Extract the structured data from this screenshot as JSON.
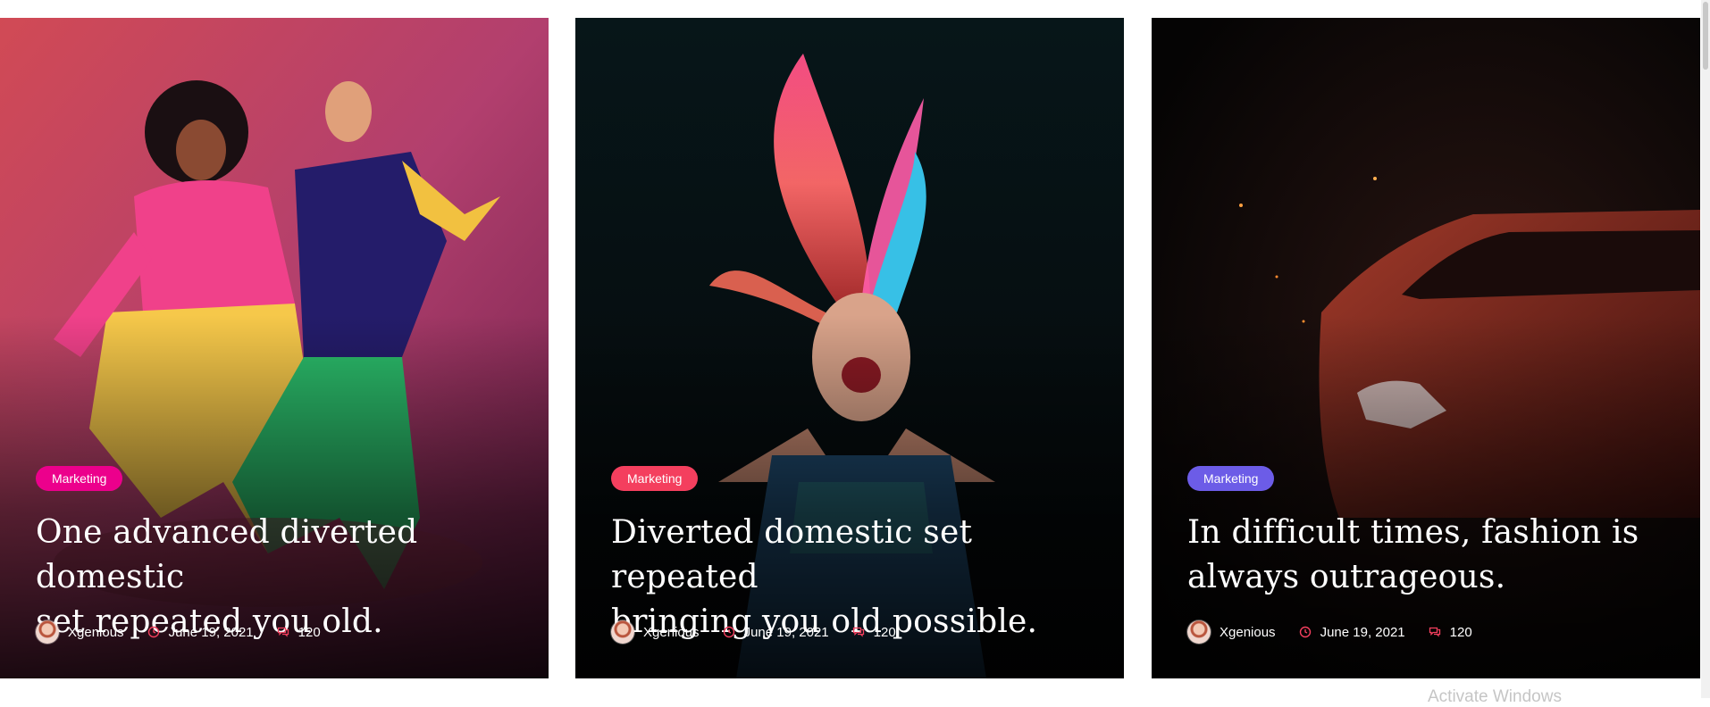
{
  "cards": [
    {
      "category": "Marketing",
      "category_color": "#ec008c",
      "title_line1": "One advanced diverted domestic",
      "title_line2": "set repeated you old.",
      "author": "Xgenious",
      "date": "June 19, 2021",
      "comments": "120"
    },
    {
      "category": "Marketing",
      "category_color": "#f43f5e",
      "title_line1": "Diverted domestic set repeated",
      "title_line2": "bringing you old possible.",
      "author": "Xgenious",
      "date": "June 19, 2021",
      "comments": "120"
    },
    {
      "category": "Marketing",
      "category_color": "#6c5ce7",
      "title_line1": "In difficult times, fashion is",
      "title_line2": "always outrageous.",
      "author": "Xgenious",
      "date": "June 19, 2021",
      "comments": "120"
    }
  ],
  "icons": {
    "author": "avatar",
    "date": "clock-icon",
    "comments": "comments-icon"
  },
  "accent_color": "#f43f5e",
  "os_overlay": {
    "text": "Activate Windows"
  }
}
